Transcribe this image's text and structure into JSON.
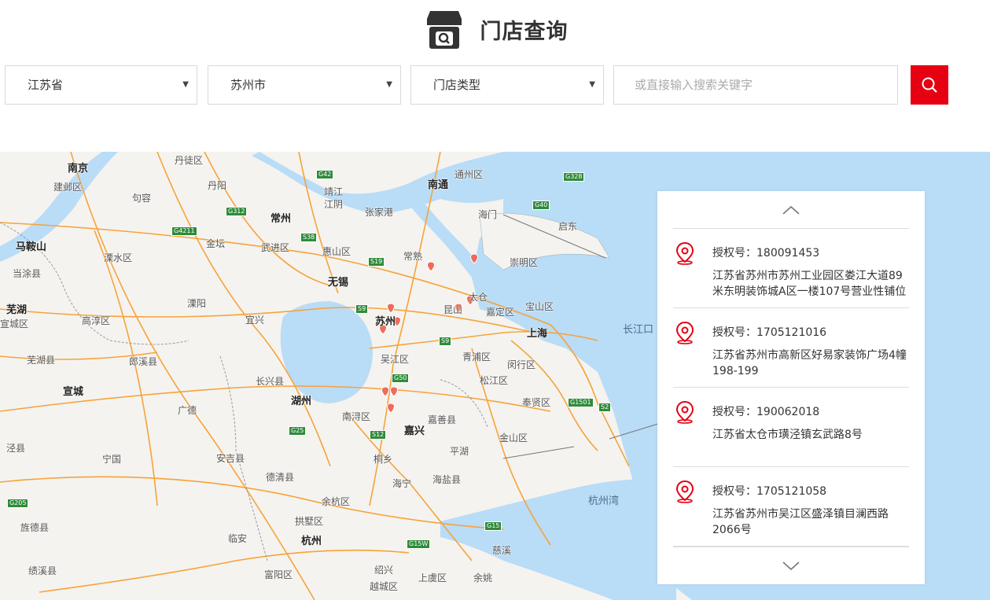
{
  "header": {
    "title": "门店查询",
    "icon": "store-search-icon"
  },
  "filters": {
    "province": "江苏省",
    "city": "苏州市",
    "store_type": "门店类型",
    "search_placeholder": "或直接输入搜索关键字",
    "caret": "▼"
  },
  "colors": {
    "accent": "#e60012",
    "water": "#b9dcf7",
    "road": "#f6a33a",
    "highway_badge": "#2e8b3a"
  },
  "map": {
    "places": {
      "nanjing": "南京",
      "dantu": "丹徒区",
      "jianye": "建邺区",
      "jurong": "句容",
      "danyang": "丹阳",
      "changzhou": "常州",
      "jingjiang": "靖江",
      "jiangyin": "江阴",
      "zhangjiagang": "张家港",
      "nantong": "南通",
      "tongzhou": "通州区",
      "haimen": "海门",
      "qidong": "启东",
      "maanshan": "马鞍山",
      "lishui": "溧水区",
      "jintan": "金坛",
      "wujin": "武进区",
      "huishan": "惠山区",
      "changshu": "常熟",
      "chongming": "崇明区",
      "dangtu": "当涂县",
      "wuxi": "无锡",
      "liyang": "溧阳",
      "yixing": "宜兴",
      "suzhou": "苏州",
      "kunshan": "昆山",
      "taicang": "太仓",
      "jiading": "嘉定区",
      "baoshan": "宝山区",
      "changjiangkou": "长江口",
      "wuhu": "芜湖",
      "gaochun": "高淳区",
      "shanghai": "上海",
      "qingpu": "青浦区",
      "minhang": "闵行区",
      "wujiang": "吴江区",
      "wuhuxian": "芜湖县",
      "langxi": "郎溪县",
      "changxing": "长兴县",
      "songjiang": "松江区",
      "xuancheng": "宣城",
      "guangde": "广德",
      "huzhou": "湖州",
      "nanxun": "南浔区",
      "jiashan": "嘉善县",
      "fengxian": "奉贤区",
      "jiaxing": "嘉兴",
      "jinshan": "金山区",
      "jingxian": "泾县",
      "ningguo": "宁国",
      "anji": "安吉县",
      "tongxiang": "桐乡",
      "pinghu": "平湖",
      "deqing": "德清县",
      "haining": "海宁",
      "haiyan": "海盐县",
      "hangzhouwan": "杭州湾",
      "yuhang": "余杭区",
      "jingde": "旌德县",
      "gongshu": "拱墅区",
      "linan": "临安",
      "hangzhou": "杭州",
      "cixi": "慈溪",
      "jixi": "绩溪县",
      "fuyang": "富阳区",
      "shaoxing": "绍兴",
      "shangyu": "上虞区",
      "yuyao": "余姚",
      "yuecheng": "越城区",
      "xuanchengqu": "宣城区"
    },
    "highways": [
      "G42",
      "G328",
      "G312",
      "G40",
      "G4211",
      "S38",
      "S19",
      "S9",
      "S9",
      "G50",
      "G1501",
      "S2",
      "G25",
      "S12",
      "G205",
      "G15",
      "G15W"
    ]
  },
  "stores": {
    "up_icon": "chevron-up-icon",
    "down_icon": "chevron-down-icon",
    "items": [
      {
        "license": "授权号：180091453",
        "address": "江苏省苏州市苏州工业园区娄江大道89米东明装饰城A区一楼107号营业性铺位"
      },
      {
        "license": "授权号：1705121016",
        "address": "江苏省苏州市高新区好易家装饰广场4幢198-199"
      },
      {
        "license": "授权号：190062018",
        "address": "江苏省太仓市璜泾镇玄武路8号"
      },
      {
        "license": "授权号：1705121058",
        "address": "江苏省苏州市吴江区盛泽镇目澜西路2066号"
      }
    ]
  }
}
